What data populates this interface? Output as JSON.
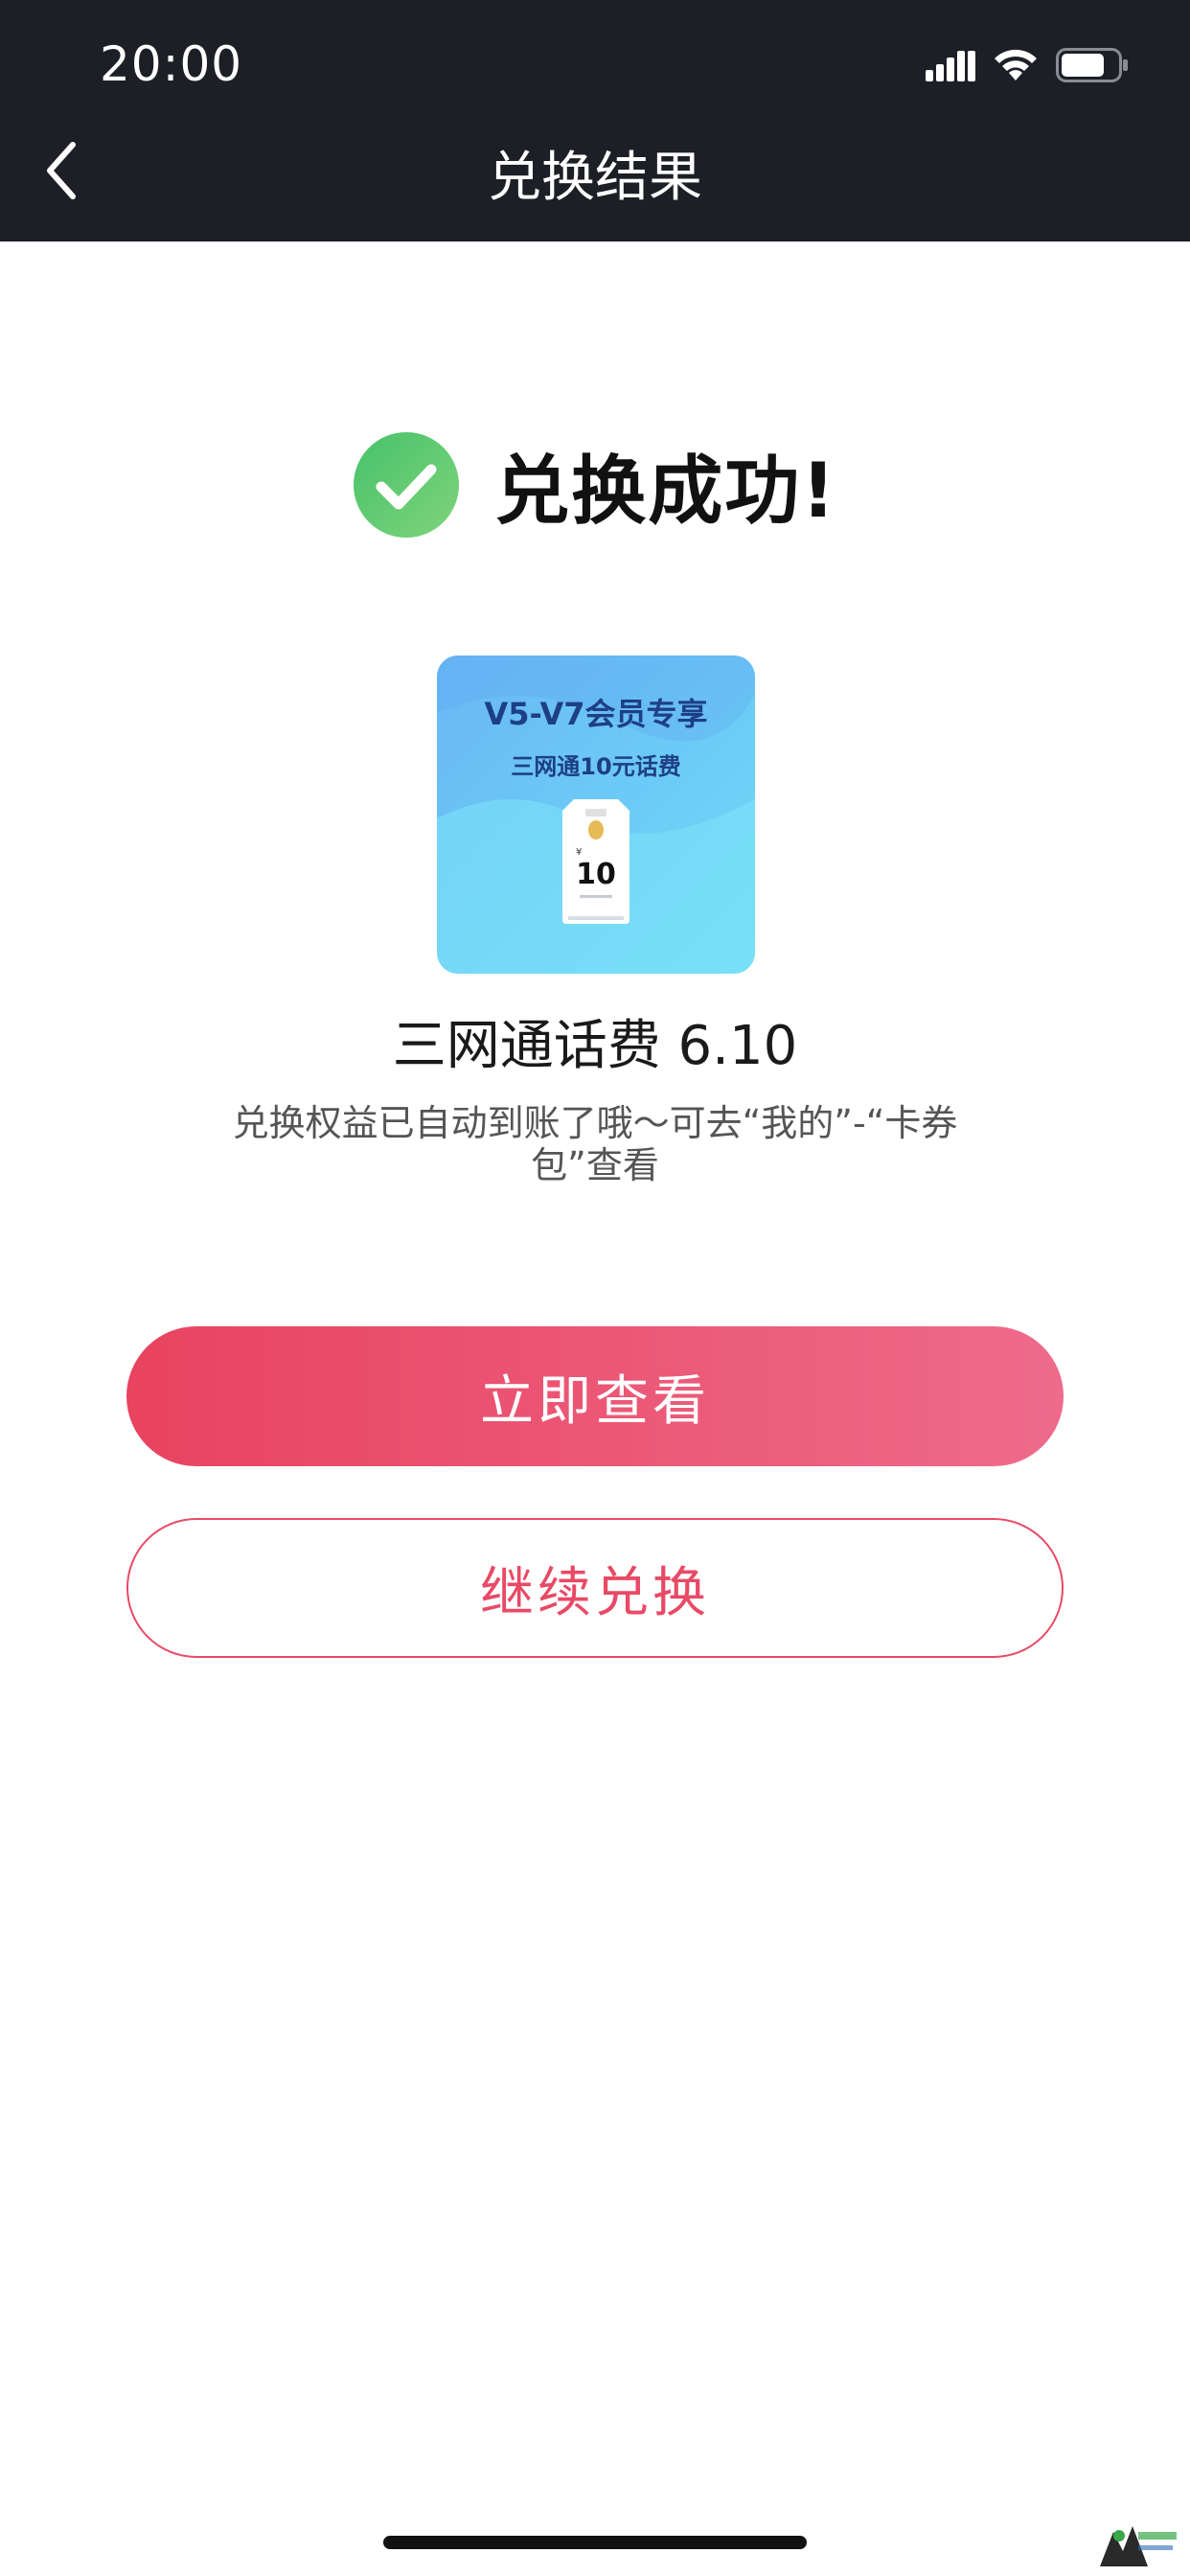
{
  "status_bar": {
    "time": "20:00"
  },
  "nav": {
    "title": "兑换结果"
  },
  "result": {
    "title": "兑换成功!",
    "status_color": "#5cc96d"
  },
  "product": {
    "image_heading": "V5-V7会员专享",
    "image_subheading": "三网通10元话费",
    "image_value": "10",
    "name": "三网通话费 6.10"
  },
  "tip": {
    "text": "兑换权益已自动到账了哦～可去“我的”-“卡券包”查看"
  },
  "buttons": {
    "primary_label": "立即查看",
    "secondary_label": "继续兑换"
  },
  "colors": {
    "header_bg": "#1d1f27",
    "accent": "#e84a66"
  }
}
